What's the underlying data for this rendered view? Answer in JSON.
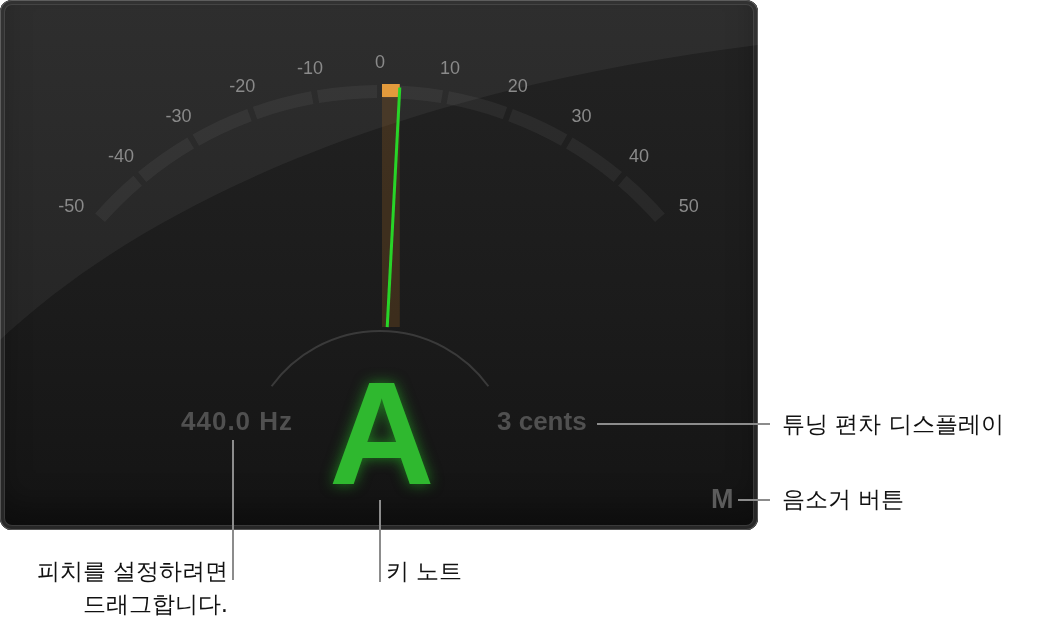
{
  "tuner": {
    "scale_labels": [
      "-50",
      "-40",
      "-30",
      "-20",
      "-10",
      "0",
      "10",
      "20",
      "30",
      "40",
      "50"
    ],
    "deviation_meter": {
      "level": 0.53
    },
    "reference_pitch": "440.0 Hz",
    "key_note": "A",
    "deviation": "3 cents",
    "mute_button": "M"
  },
  "callouts": [
    {
      "kind": "deviation",
      "text": "튜닝 편차 디스플레이"
    },
    {
      "kind": "mute",
      "text": "음소거 버튼"
    },
    {
      "kind": "pitch",
      "text": "피치를 설정하려면 드래그합니다."
    },
    {
      "kind": "note",
      "text": "키 노트"
    }
  ]
}
